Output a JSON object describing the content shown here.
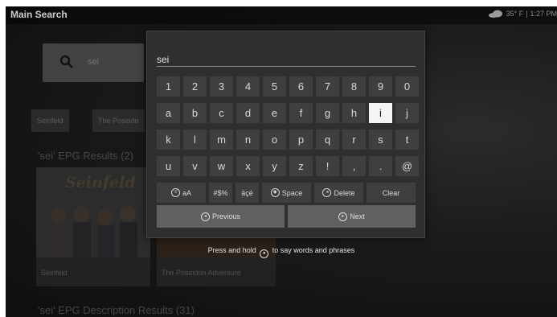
{
  "app_title": "Main Search",
  "status": {
    "weather_icon": "cloud-icon",
    "temperature": "35° F",
    "divider": "|",
    "time": "1:27 PM"
  },
  "search": {
    "query": "sei",
    "icon": "search-icon"
  },
  "chips": [
    "Seinfeld",
    "The Poseido"
  ],
  "sections": {
    "epg_title": "'sei' EPG Results (2)",
    "desc_title": "'sei' EPG Description Results (31)"
  },
  "posters": [
    {
      "caption": "Seinfeld",
      "logo": "Seinfeld"
    },
    {
      "caption": "The Poseidon Adventure"
    }
  ],
  "keyboard": {
    "input_value": "sei",
    "rows": [
      [
        "1",
        "2",
        "3",
        "4",
        "5",
        "6",
        "7",
        "8",
        "9",
        "0"
      ],
      [
        "a",
        "b",
        "c",
        "d",
        "e",
        "f",
        "g",
        "h",
        "i",
        "j"
      ],
      [
        "k",
        "l",
        "m",
        "n",
        "o",
        "p",
        "q",
        "r",
        "s",
        "t"
      ],
      [
        "u",
        "v",
        "w",
        "x",
        "y",
        "z",
        "!",
        ",",
        ".",
        "@"
      ]
    ],
    "selected_key": "i",
    "bottom_row": {
      "case_label": "aA",
      "symbols": "#$%",
      "accents": "äçé",
      "space": "Space",
      "delete": "Delete",
      "clear": "Clear"
    },
    "previous": "Previous",
    "next": "Next",
    "hint_before": "Press and hold",
    "hint_after": "to say words and phrases"
  }
}
